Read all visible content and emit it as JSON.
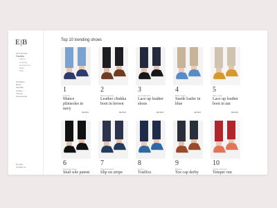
{
  "logo": "E|B",
  "nav": {
    "main": [
      "New arrivals",
      "Trending"
    ],
    "sub": [
      "Shoes",
      "Clothing",
      "Accessories",
      "Bags",
      "Sale"
    ],
    "secondary": [
      "Sneakers",
      "Boots",
      "Sandals",
      "Loafers",
      "Formal",
      "Accessories"
    ],
    "bottom": [
      "My bag",
      "Contact us"
    ]
  },
  "page_title": "Top 10 trending shoes",
  "products": [
    {
      "num": "1",
      "brand": "Lacoste",
      "name": "Mance plimsoles in navy",
      "price": "49.58 €",
      "shoe": "#2d3a6a",
      "pants": "#7aa4cf",
      "skin": "#e9c7b5",
      "bg": "#f4f2f1"
    },
    {
      "num": "2",
      "brand": "Bowen Kenway",
      "name": "Leather chukka boot in brown",
      "price": "89.58 €",
      "shoe": "#6e3c22",
      "pants": "#1d1e24",
      "skin": "#e1c0aa",
      "bg": "#f5f4f3"
    },
    {
      "num": "3",
      "brand": "Fenix Alberstin",
      "name": "Lace up leather shoes",
      "price": "89.58 €",
      "shoe": "#181818",
      "pants": "#222a3b",
      "skin": "#e5c5b0",
      "bg": "#f4f3f3"
    },
    {
      "num": "4",
      "brand": "Bata Garcia",
      "name": "Suede loafer in blue",
      "price": "49.58 €",
      "shoe": "#5b8bc4",
      "pants": "#c7b498",
      "skin": "#eccab4",
      "bg": "#f4f3f3"
    },
    {
      "num": "5",
      "brand": "Bob Louisa",
      "name": "Lace up leather boot in tan",
      "price": "89.58 €",
      "shoe": "#d69a2c",
      "pants": "#cfc3b1",
      "skin": "#e7c4ad",
      "bg": "#f6f5f4"
    },
    {
      "num": "6",
      "brand": "Boulogne Dixon",
      "name": "Stud sole patent",
      "shoe": "#111",
      "pants": "#111",
      "skin": "#e3c2ad",
      "bg": "#f4f3f3"
    },
    {
      "num": "7",
      "brand": "Original Puppet",
      "name": "Slip on stripe",
      "shoe": "#233c5c",
      "pants": "#2b344c",
      "skin": "#e5c4b1",
      "bg": "#f4f3f3"
    },
    {
      "num": "8",
      "brand": "Trueno",
      "name": "Trailfox overland",
      "shoe": "#2e69a6",
      "pants": "#1e2b4a",
      "skin": "#e9c8b6",
      "bg": "#f4f3f3"
    },
    {
      "num": "9",
      "brand": "Borlano",
      "name": "Toe cap derby",
      "shoe": "#9a4a2a",
      "pants": "#2a2e3a",
      "skin": "#e2c1ac",
      "bg": "#f4f3f3"
    },
    {
      "num": "10",
      "brand": "Adidas Originals",
      "name": "Temper run",
      "shoe": "#e07558",
      "pants": "#b1252d",
      "skin": "#e9c8b6",
      "bg": "#f4f3f3"
    }
  ]
}
